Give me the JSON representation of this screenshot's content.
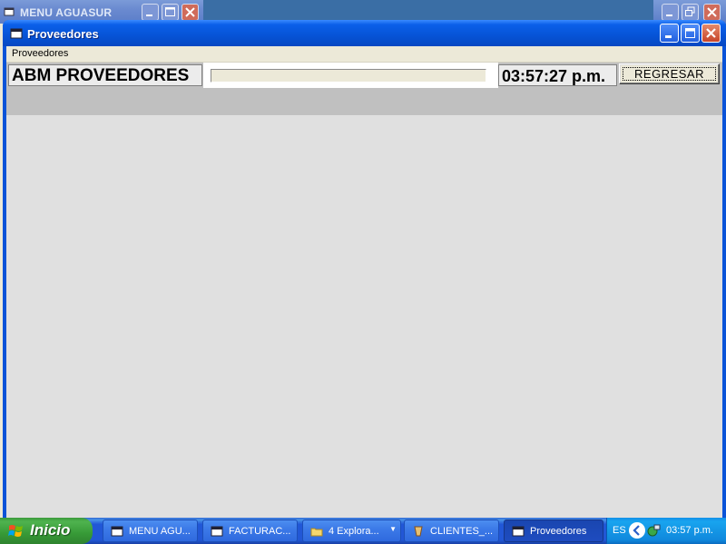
{
  "background_window": {
    "title": "MENU AGUASUR"
  },
  "window": {
    "title": "Proveedores"
  },
  "menubar": {
    "items": [
      {
        "label": "Proveedores"
      }
    ]
  },
  "header": {
    "title": "ABM PROVEEDORES",
    "search_value": "",
    "time": "03:57:27 p.m.",
    "regresar_label": "REGRESAR"
  },
  "taskbar": {
    "start_label": "Inicio",
    "tasks": [
      {
        "label": "MENU AGU...",
        "icon": "window-icon"
      },
      {
        "label": "FACTURAC...",
        "icon": "window-icon"
      },
      {
        "label": "4 Explora...",
        "icon": "folder-icon"
      },
      {
        "label": "CLIENTES_...",
        "icon": "app-icon"
      },
      {
        "label": "Proveedores",
        "icon": "window-icon"
      }
    ],
    "language": "ES",
    "clock": "03:57 p.m."
  },
  "colors": {
    "title_bar": "#0653d6",
    "client_bg": "#e0e0e0",
    "header_panel": "#c0c0c0",
    "taskbar": "#2257d5",
    "start_button": "#379a37",
    "tray": "#1088dc"
  }
}
